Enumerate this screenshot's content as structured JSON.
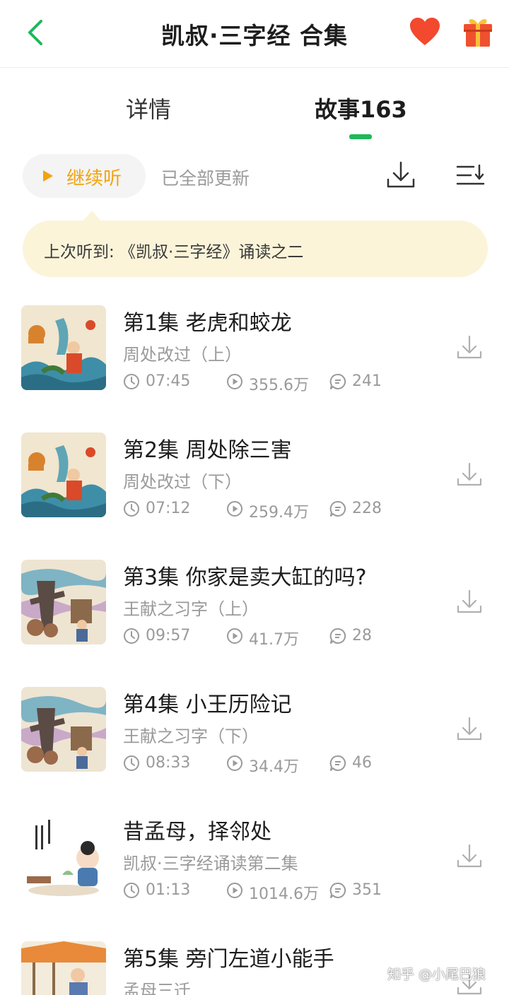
{
  "header": {
    "title": "凯叔·三字经 合集"
  },
  "tabs": {
    "detail": "详情",
    "stories": "故事163"
  },
  "toolbar": {
    "continue_label": "继续听",
    "status": "已全部更新"
  },
  "last_played": {
    "text": "上次听到: 《凯叔·三字经》诵读之二"
  },
  "episodes": [
    {
      "title": "第1集 老虎和蛟龙",
      "subtitle": "周处改过（上）",
      "duration": "07:45",
      "plays": "355.6万",
      "comments": "241"
    },
    {
      "title": "第2集  周处除三害",
      "subtitle": "周处改过（下）",
      "duration": "07:12",
      "plays": "259.4万",
      "comments": "228"
    },
    {
      "title": "第3集 你家是卖大缸的吗?",
      "subtitle": "王献之习字（上）",
      "duration": "09:57",
      "plays": "41.7万",
      "comments": "28"
    },
    {
      "title": "第4集 小王历险记",
      "subtitle": "王献之习字（下）",
      "duration": "08:33",
      "plays": "34.4万",
      "comments": "46"
    },
    {
      "title": "昔孟母，择邻处",
      "subtitle": "凯叔·三字经诵读第二集",
      "duration": "01:13",
      "plays": "1014.6万",
      "comments": "351"
    },
    {
      "title": "第5集 旁门左道小能手",
      "subtitle": "孟母三迁",
      "duration": "",
      "plays": "",
      "comments": ""
    }
  ],
  "watermark": "知乎 @小尾巴狼",
  "colors": {
    "accent_green": "#1eb85a",
    "continue_orange": "#f2a310",
    "heart_red": "#f2492f",
    "bubble_bg": "#fbf4d9"
  }
}
